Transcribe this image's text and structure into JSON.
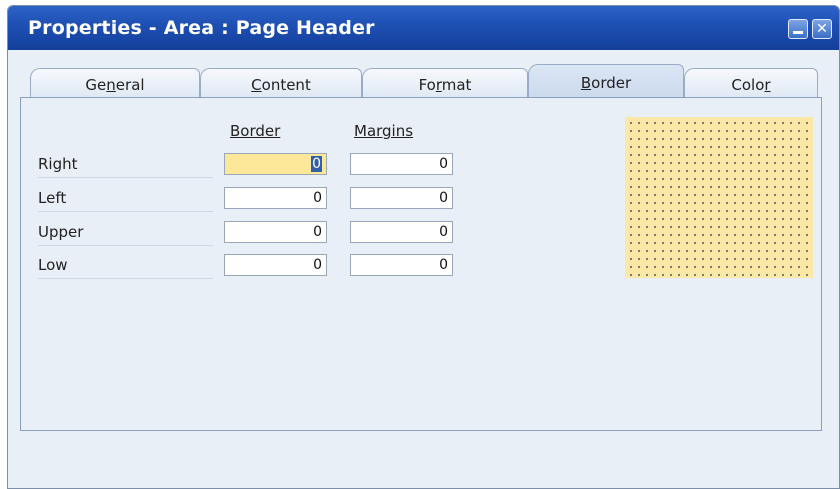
{
  "window": {
    "title": "Properties - Area : Page Header"
  },
  "tabs": [
    {
      "pre": "Ge",
      "mn": "n",
      "post": "eral",
      "active": false
    },
    {
      "pre": "",
      "mn": "C",
      "post": "ontent",
      "active": false
    },
    {
      "pre": "Fo",
      "mn": "r",
      "post": "mat",
      "active": false
    },
    {
      "pre": "",
      "mn": "B",
      "post": "order",
      "active": true
    },
    {
      "pre": "Colo",
      "mn": "r",
      "post": "",
      "active": false
    }
  ],
  "form": {
    "border_header": "Border",
    "margins_header": "Margins",
    "rows": [
      {
        "label": "Right",
        "border": "0",
        "margin": "0"
      },
      {
        "label": "Left",
        "border": "0",
        "margin": "0"
      },
      {
        "label": "Upper",
        "border": "0",
        "margin": "0"
      },
      {
        "label": "Low",
        "border": "0",
        "margin": "0"
      }
    ]
  },
  "colors": {
    "preview_fill": "#fbe8a6",
    "focused_field": "#fde89a",
    "titlebar": "#1d4fb3"
  }
}
